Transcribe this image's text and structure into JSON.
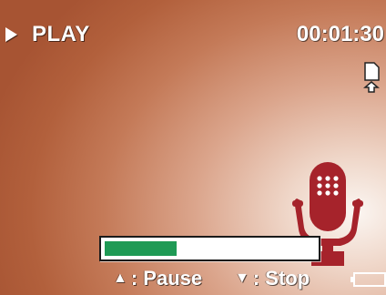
{
  "status": {
    "mode_icon": "play-icon",
    "mode_label": "PLAY",
    "timer": "00:01:30"
  },
  "icons": {
    "memory_card": "sd-card-icon",
    "microphone": "microphone-icon",
    "battery": "battery-icon"
  },
  "progress": {
    "fraction": 0.34,
    "fill_color": "#1f9a55"
  },
  "controls": {
    "pause": {
      "arrow": "▲",
      "label": ": Pause"
    },
    "stop": {
      "arrow": "▼",
      "label": ": Stop"
    }
  },
  "colors": {
    "mic": "#a6232b",
    "background_dark": "#a75433",
    "background_light": "#fbf6f2"
  }
}
